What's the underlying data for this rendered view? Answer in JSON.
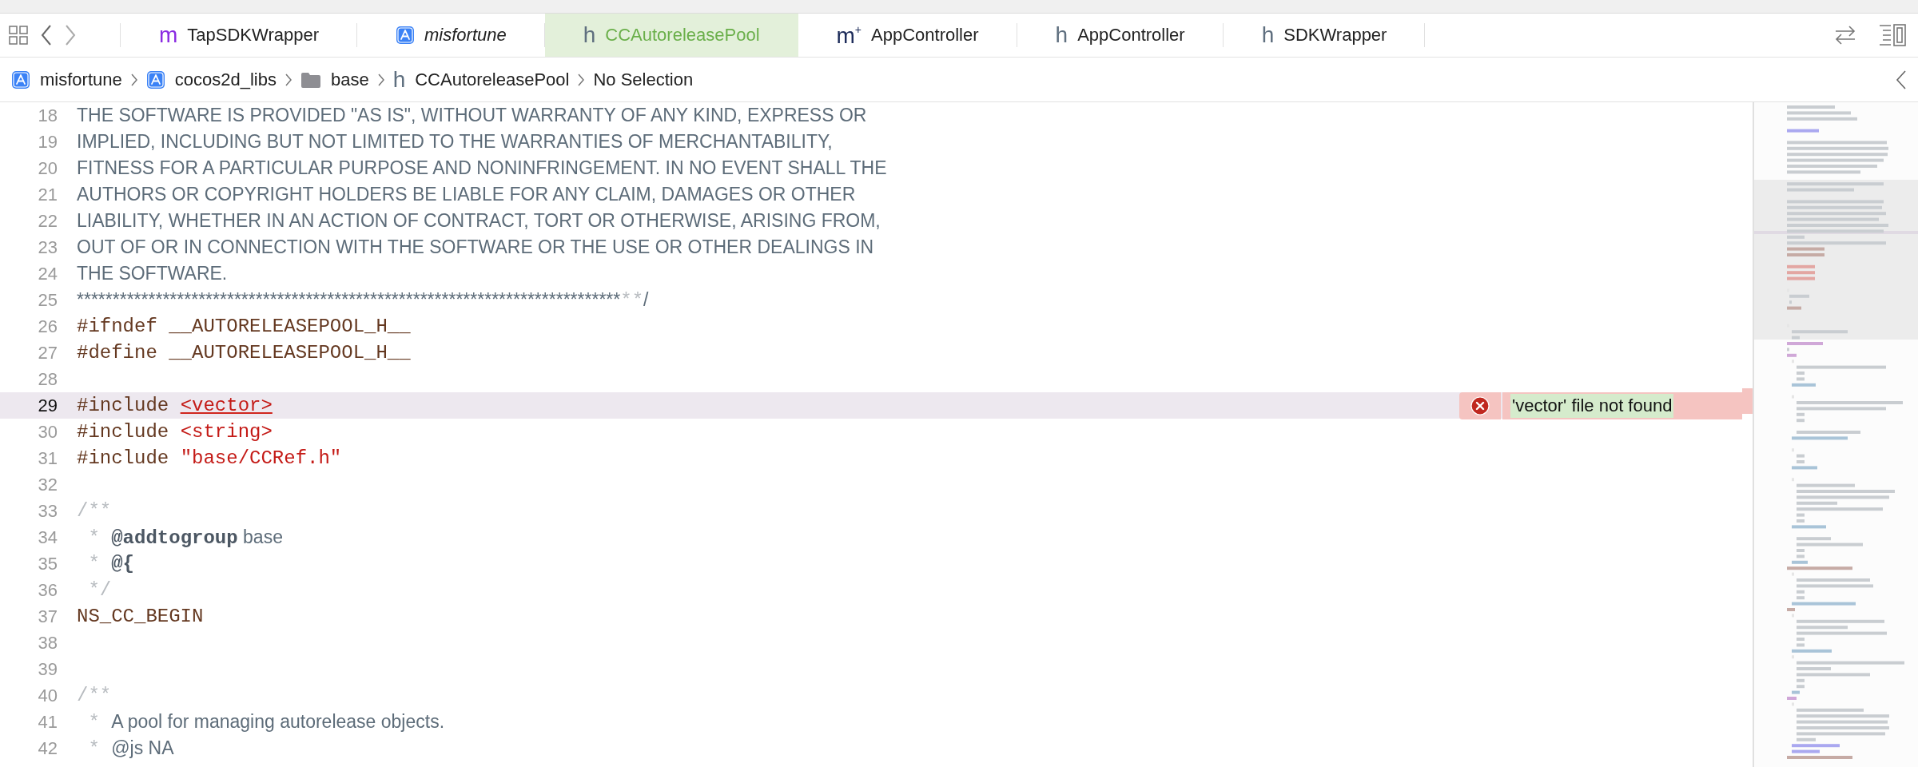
{
  "tabs": [
    {
      "kind": "objc",
      "glyph": "m",
      "label": "TapSDKWrapper",
      "selected": false,
      "preview": false
    },
    {
      "kind": "app",
      "label": "misfortune",
      "selected": false,
      "preview": true
    },
    {
      "kind": "header",
      "glyph": "h",
      "label": "CCAutoreleasePool",
      "selected": true,
      "preview": false
    },
    {
      "kind": "objcpp",
      "glyph": "m",
      "sup": "+",
      "label": "AppController",
      "selected": false,
      "preview": false
    },
    {
      "kind": "header",
      "glyph": "h",
      "label": "AppController",
      "selected": false,
      "preview": false
    },
    {
      "kind": "header",
      "glyph": "h",
      "label": "SDKWrapper",
      "selected": false,
      "preview": false
    }
  ],
  "breadcrumb": [
    {
      "kind": "app",
      "label": "misfortune"
    },
    {
      "kind": "app",
      "label": "cocos2d_libs"
    },
    {
      "kind": "folder",
      "label": "base"
    },
    {
      "kind": "header",
      "glyph": "h",
      "label": "CCAutoreleasePool"
    },
    {
      "kind": "plain",
      "label": "No Selection"
    }
  ],
  "code": {
    "lines": [
      {
        "number": "18",
        "current": false,
        "tokens": [
          {
            "kind": "doc",
            "text": "THE SOFTWARE IS PROVIDED \"AS IS\", WITHOUT WARRANTY OF ANY KIND, EXPRESS OR"
          }
        ]
      },
      {
        "number": "19",
        "current": false,
        "tokens": [
          {
            "kind": "doc",
            "text": "IMPLIED, INCLUDING BUT NOT LIMITED TO THE WARRANTIES OF MERCHANTABILITY,"
          }
        ]
      },
      {
        "number": "20",
        "current": false,
        "tokens": [
          {
            "kind": "doc",
            "text": "FITNESS FOR A PARTICULAR PURPOSE AND NONINFRINGEMENT. IN NO EVENT SHALL THE"
          }
        ]
      },
      {
        "number": "21",
        "current": false,
        "tokens": [
          {
            "kind": "doc",
            "text": "AUTHORS OR COPYRIGHT HOLDERS BE LIABLE FOR ANY CLAIM, DAMAGES OR OTHER"
          }
        ]
      },
      {
        "number": "22",
        "current": false,
        "tokens": [
          {
            "kind": "doc",
            "text": "LIABILITY, WHETHER IN AN ACTION OF CONTRACT, TORT OR OTHERWISE, ARISING FROM,"
          }
        ]
      },
      {
        "number": "23",
        "current": false,
        "tokens": [
          {
            "kind": "doc",
            "text": "OUT OF OR IN CONNECTION WITH THE SOFTWARE OR THE USE OR OTHER DEALINGS IN"
          }
        ]
      },
      {
        "number": "24",
        "current": false,
        "tokens": [
          {
            "kind": "doc",
            "text": "THE SOFTWARE."
          }
        ]
      },
      {
        "number": "25",
        "current": false,
        "tokens": [
          {
            "kind": "doc",
            "text": "****************************************************************************"
          },
          {
            "kind": "mark",
            "text": "**"
          },
          {
            "kind": "doc",
            "text": "/"
          }
        ]
      },
      {
        "number": "26",
        "current": false,
        "tokens": [
          {
            "kind": "directive",
            "text": "#ifndef __AUTORELEASEPOOL_H__"
          }
        ]
      },
      {
        "number": "27",
        "current": false,
        "tokens": [
          {
            "kind": "directive",
            "text": "#define __AUTORELEASEPOOL_H__"
          }
        ]
      },
      {
        "number": "28",
        "current": false
      },
      {
        "number": "29",
        "current": true,
        "tokens": [
          {
            "kind": "directive",
            "text": "#include "
          },
          {
            "kind": "error_string",
            "text": "<vector>"
          }
        ],
        "error": {
          "message": "'vector' file not found"
        }
      },
      {
        "number": "30",
        "current": false,
        "tokens": [
          {
            "kind": "directive",
            "text": "#include "
          },
          {
            "kind": "string",
            "text": "<string>"
          }
        ]
      },
      {
        "number": "31",
        "current": false,
        "tokens": [
          {
            "kind": "directive",
            "text": "#include "
          },
          {
            "kind": "string",
            "text": "\"base/CCRef.h\""
          }
        ]
      },
      {
        "number": "32",
        "current": false
      },
      {
        "number": "33",
        "current": false,
        "tokens": [
          {
            "kind": "mark",
            "text": "/**"
          }
        ]
      },
      {
        "number": "34",
        "current": false,
        "tokens": [
          {
            "kind": "mark",
            "text": " * "
          },
          {
            "kind": "doc_keyword",
            "text": "@addtogroup"
          },
          {
            "kind": "doc",
            "text": " base"
          }
        ]
      },
      {
        "number": "35",
        "current": false,
        "tokens": [
          {
            "kind": "mark",
            "text": " * "
          },
          {
            "kind": "doc_keyword",
            "text": "@{"
          }
        ]
      },
      {
        "number": "36",
        "current": false,
        "tokens": [
          {
            "kind": "mark",
            "text": " */"
          }
        ]
      },
      {
        "number": "37",
        "current": false,
        "tokens": [
          {
            "kind": "directive",
            "text": "NS_CC_BEGIN"
          }
        ]
      },
      {
        "number": "38",
        "current": false
      },
      {
        "number": "39",
        "current": false
      },
      {
        "number": "40",
        "current": false,
        "tokens": [
          {
            "kind": "mark",
            "text": "/**"
          }
        ]
      },
      {
        "number": "41",
        "current": false,
        "tokens": [
          {
            "kind": "mark",
            "text": " * "
          },
          {
            "kind": "doc",
            "text": "A pool for managing autorelease objects."
          }
        ]
      },
      {
        "number": "42",
        "current": false,
        "tokens": [
          {
            "kind": "mark",
            "text": " * "
          },
          {
            "kind": "doc",
            "text": "@js NA"
          }
        ]
      }
    ]
  }
}
